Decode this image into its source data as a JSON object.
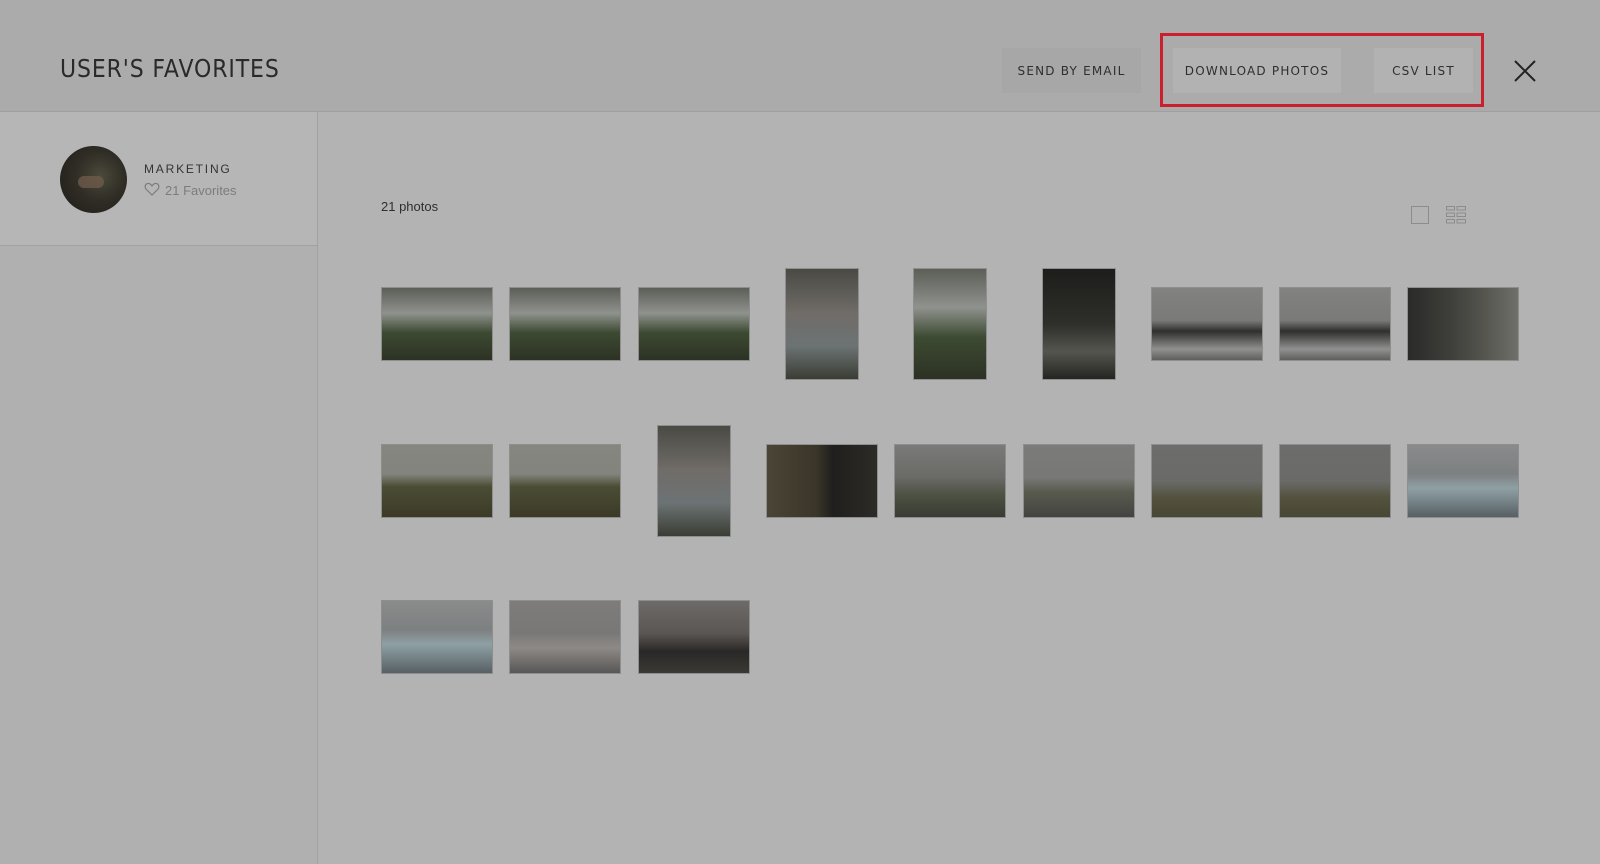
{
  "header": {
    "title": "USER'S FAVORITES",
    "buttons": {
      "send_email": "SEND BY EMAIL",
      "download_photos": "DOWNLOAD PHOTOS",
      "csv_list": "CSV LIST"
    }
  },
  "sidebar": {
    "user": {
      "name": "MARKETING",
      "favorites": "21 Favorites"
    }
  },
  "main": {
    "photo_count": "21 photos",
    "photos": [
      {
        "orientation": "landscape",
        "scene": "waterfall"
      },
      {
        "orientation": "landscape",
        "scene": "waterfall"
      },
      {
        "orientation": "landscape",
        "scene": "waterfall"
      },
      {
        "orientation": "portrait",
        "scene": "couple-portrait"
      },
      {
        "orientation": "portrait",
        "scene": "waterfall"
      },
      {
        "orientation": "portrait",
        "scene": "cave"
      },
      {
        "orientation": "landscape",
        "scene": "sea-stacks"
      },
      {
        "orientation": "landscape",
        "scene": "sea-stacks"
      },
      {
        "orientation": "landscape",
        "scene": "basalt-cliff"
      },
      {
        "orientation": "landscape",
        "scene": "moss-field"
      },
      {
        "orientation": "landscape",
        "scene": "moss-field"
      },
      {
        "orientation": "portrait",
        "scene": "couple-portrait"
      },
      {
        "orientation": "landscape",
        "scene": "close-up"
      },
      {
        "orientation": "landscape",
        "scene": "foggy-mountain"
      },
      {
        "orientation": "landscape",
        "scene": "road"
      },
      {
        "orientation": "landscape",
        "scene": "foggy-field"
      },
      {
        "orientation": "landscape",
        "scene": "foggy-field"
      },
      {
        "orientation": "landscape",
        "scene": "glacier-lagoon"
      },
      {
        "orientation": "landscape",
        "scene": "glacier-lagoon"
      },
      {
        "orientation": "landscape",
        "scene": "beach"
      },
      {
        "orientation": "landscape",
        "scene": "couple-embrace"
      }
    ]
  },
  "colors": {
    "highlight": "#cc1f2d",
    "overlay_gray": "#b3b3b3"
  }
}
